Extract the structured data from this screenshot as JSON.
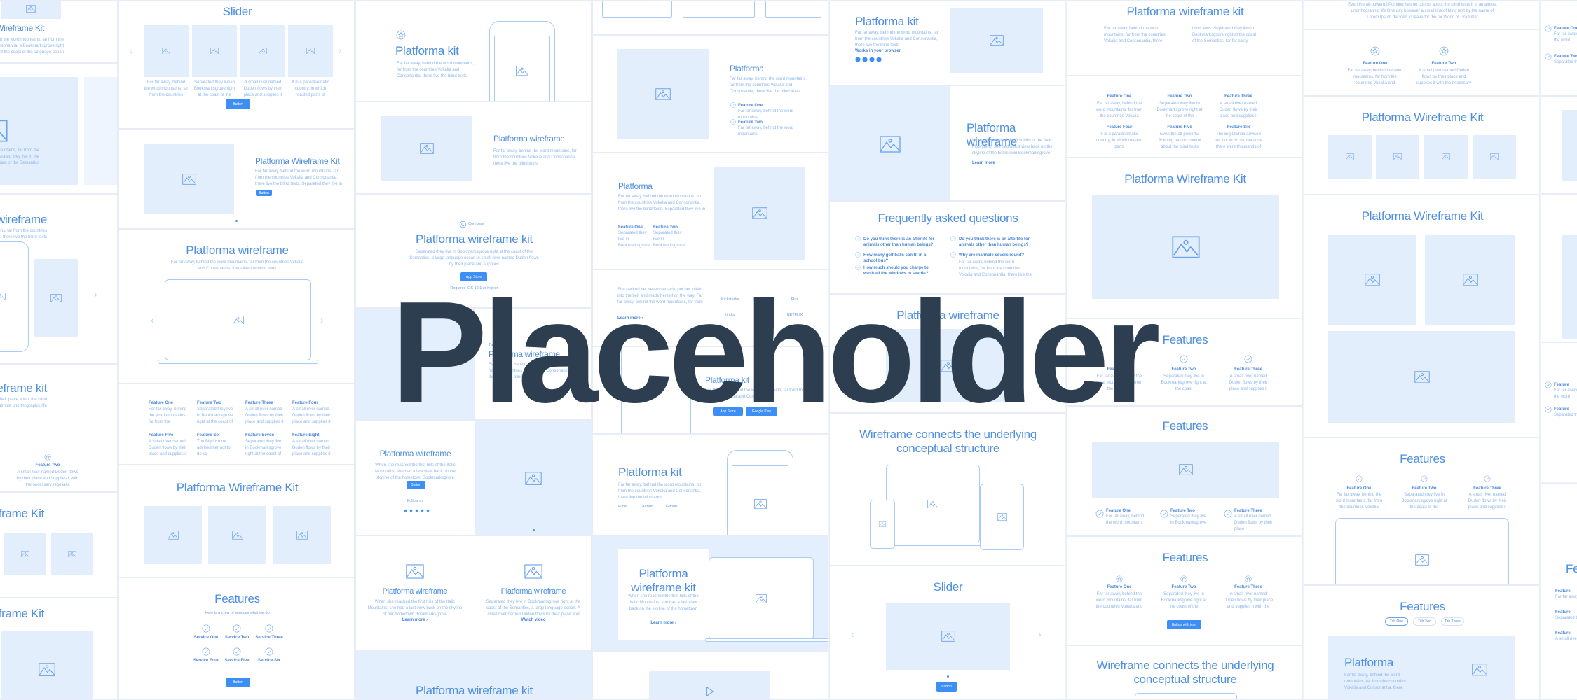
{
  "overlay_text": "Placeholder",
  "colors": {
    "accent": "#3d8ef5",
    "title": "#4d8fe2",
    "image_fill": "#e3eefd",
    "overlay": "#2c3e50"
  },
  "columns": [
    {
      "sections": [
        {
          "title": "Platforma Wireframe Kit",
          "body": "Far far away, behind the word mountains, far from the countries Vokalia and Consonantia, a Bookmarksgrove right at the coast of the language ocean"
        },
        {
          "body": "Far far away, behind the word mountains, far from the countries Vokalia and Consonantia. Separated they live in the coast of the Semantics"
        },
        {
          "title": "Platforma wireframe",
          "body": "Far far away, behind the word mountains, far from the countries Vokalia, there live the blind texts"
        },
        {
          "title": "Platforma wireframe kit",
          "body": "A small river named Duden flows by their place about the blind texts it is an almost unorthographic life",
          "items": [
            {
              "label": "Feature Two",
              "text": "A small river named Duden flows by their place and supplies it with the necessary regelialia"
            }
          ]
        },
        {
          "title": "Platforma Wireframe Kit"
        },
        {
          "title": "Platforma Wireframe Kit"
        }
      ]
    },
    {
      "sections": [
        {
          "title": "Slider",
          "button": "Button",
          "items": [
            {
              "text": "Far far away, behind the word mountains, far from the countries Vokalia and Consonantia"
            },
            {
              "text": "Separated they live in Bookmarksgrove right at the coast of the Semantics"
            },
            {
              "text": "A small river named Duden flows by their place and supplies it with the necessary regelialia"
            },
            {
              "text": "It is a paradisematic country, in which roasted parts of sentences fly into your mouth"
            }
          ]
        },
        {
          "title": "Platforma Wireframe Kit",
          "body": "Far far away, behind the word mountains, far from the countries Vokalia and Consonantia, there live the blind texts. Separated they live in Bookmarksgrove right at the coast of the Semantics, a large language ocean.",
          "button": "Button"
        },
        {
          "title": "Platforma wireframe",
          "body": "Far far away, behind the word mountains, far from the countries Vokalia and Consonantia, there live the blind texts"
        },
        {
          "items": [
            {
              "label": "Feature One",
              "text": "Far far away, behind the word mountains, far from the countries Vokalia"
            },
            {
              "label": "Feature Two",
              "text": "Separated they live in Bookmarksgrove right at the coast of the Semantics"
            },
            {
              "label": "Feature Three",
              "text": "A small river named Duden flows by their place and supplies it with"
            },
            {
              "label": "Feature Four",
              "text": "A small river named Duden flows by their place and supplies it with"
            },
            {
              "label": "Feature Five",
              "text": "A small river named Duden flows by their place and supplies it with"
            },
            {
              "label": "Feature Six",
              "text": "The Big Oxmox advised her not to do so"
            },
            {
              "label": "Feature Seven",
              "text": "Separated they live in Bookmarksgrove right at the coast of the Semantics"
            },
            {
              "label": "Feature Eight",
              "text": "A small river named Duden flows by their place and supplies it with"
            }
          ]
        },
        {
          "title": "Platforma Wireframe Kit"
        },
        {
          "title": "Features",
          "subtitle": "Here is a crew of services what we do",
          "button": "Button",
          "items": [
            {
              "label": "Service One"
            },
            {
              "label": "Service Two"
            },
            {
              "label": "Service Three"
            },
            {
              "label": "Service Four"
            },
            {
              "label": "Service Five"
            },
            {
              "label": "Service Six"
            }
          ]
        }
      ]
    },
    {
      "sections": [
        {
          "title": "Platforma kit",
          "body": "Far far away, behind the word mountains, far from the countries Vokalia and Consonantia, there live the blind texts"
        },
        {
          "title": "Platforma wireframe",
          "body": "Far far away, behind the word mountains, far from the countries Vokalia and Consonantia, there live the blind texts"
        },
        {
          "company": "Company",
          "title": "Platforma wireframe kit",
          "body": "Separated they live in Bookmarksgrove right at the coast of the Semantics, a large language ocean. A small river named Duden flows by their place and supplies",
          "badge": "App Store",
          "note": "Requires iOS 10.1 or higher"
        },
        {
          "tag": "Tag",
          "title": "Platforma wireframe",
          "body": "Far far away, behind the word mountains, far from the countries Vokalia and Consonantia, there live the blind texts"
        },
        {
          "title": "Platforma wireframe",
          "body": "When she reached the first hills of the Italic Mountains, she had a last view back on the skyline of the hometown Bookmarksgrove",
          "button": "Button",
          "follow": "Follow us"
        },
        {
          "cards": [
            {
              "title": "Platforma wireframe",
              "body": "When she reached the first hills of the Italic Mountains, she had a last view back on the skyline of her hometown Bookmarksgrove",
              "link": "Learn more ›"
            },
            {
              "title": "Platforma wireframe",
              "body": "Separated they live in Bookmarksgrove right at the coast of the Semantics, a large language ocean. A small river named Duden flows by their place and supplies it",
              "link": "Watch video"
            }
          ]
        },
        {
          "title": "Platforma wireframe kit"
        }
      ]
    },
    {
      "sections": [
        {},
        {
          "title": "Platforma",
          "body": "Far far away, behind the word mountains, far from the countries Vokalia and Consonantia, there live the blind texts",
          "items": [
            {
              "label": "Feature One",
              "text": "Far far away, behind the word mountains"
            },
            {
              "label": "Feature Two",
              "text": "Far far away, behind the word mountains"
            }
          ]
        },
        {
          "title": "Platforma",
          "body": "Far far away, behind the word mountains, far from the countries Vokalia and Consonantia, there live the blind texts. Separated they live in Bookmarksgrove right at the coast of the Semantics, a large language ocean",
          "items": [
            {
              "label": "Feature One",
              "text": "Separated they live in Bookmarksgrove"
            },
            {
              "label": "Feature Two",
              "text": "Separated they live in Bookmarksgrove"
            }
          ]
        },
        {
          "body": "She packed her seven versalia, put her initial into the belt and made herself on the way. Far far away, behind the word mountains, far from the countries Vokalia",
          "link": "Learn more ›",
          "logos": [
            "Kickstarter",
            "BEYOND",
            "Flux",
            "tinder",
            "Adobe",
            "NETFLIX"
          ]
        },
        {
          "title": "Platforma kit",
          "body": "Far far away, behind the word mountains, far from the countries Vokalia and Consonantia",
          "badges": [
            "App Store",
            "Google Play"
          ]
        },
        {
          "title": "Platforma kit",
          "body": "Far far away, behind the word mountains, far from the countries Vokalia and Consonantia, there live the blind texts",
          "logos": [
            "Flickr",
            "Airbnb",
            "Github"
          ]
        },
        {
          "title": "Platforma wireframe kit",
          "body": "When she reached the first hills of the Italic Mountains, she had a last view back on the skyline of the hometown Bookmarksgrove",
          "link": "Learn more ›"
        },
        {}
      ]
    },
    {
      "sections": [
        {
          "title": "Platforma kit",
          "body": "Far far away, behind the word mountains, far from the countries Vokalia and Consonantia, there live the blind texts",
          "browser_label": "Works in your browser"
        },
        {
          "title": "Platforma wireframe",
          "body": "When she reached the first hills of the Italic Mountains, she had a last view back on the skyline of the hometown Bookmarksgrove",
          "link": "Learn more ›"
        },
        {
          "title": "Frequently asked questions",
          "questions": [
            "Do you think there is an afterlife for animals other than human beings?",
            "How many golf balls can fit in a school bus?",
            "How much should you charge to wash all the windows in seattle?",
            "Do you think there is an afterlife for animals other than human beings?",
            "Why are manhole covers round?"
          ],
          "answer": "Far far away, behind the word mountains, far from the countries Vokalia and Consonantia, there live the blind texts"
        },
        {
          "title": "Platforma wireframe"
        },
        {
          "title": "Wireframe connects the underlying conceptual structure"
        },
        {
          "title": "Slider",
          "button": "Button"
        }
      ]
    },
    {
      "sections": [
        {
          "title": "Platforma wireframe kit",
          "body_left": "Far far away, behind the word mountains, far from the countries Vokalia and Consonantia, there live the blind texts. Separated they live in Bookmarksgrove right at the coast of the Semantics, a large language ocean.",
          "body_right": "blind texts. Separated they live in Bookmarksgrove right at the coast of the Semantics, far far away, behind the word mountains, far from the countries Vokalia and Consonantia"
        },
        {
          "items": [
            {
              "label": "Feature One",
              "text": "Far far away, behind the word mountains, far from the countries Vokalia"
            },
            {
              "label": "Feature Two",
              "text": "Separated they live in Bookmarksgrove right at the coast of the Semantics"
            },
            {
              "label": "Feature Three",
              "text": "A small river named Duden flows by their place and supplies it"
            },
            {
              "label": "Feature Four",
              "text": "It is a paradisematic country, in which roasted parts"
            },
            {
              "label": "Feature Five",
              "text": "Even the all-powerful Pointing has no control about the blind texts"
            },
            {
              "label": "Feature Six",
              "text": "The Big Oxmox advised her not to do so, because there were thousands of bad Commas"
            }
          ]
        },
        {
          "title": "Platforma Wireframe Kit"
        },
        {
          "title": "Features",
          "items": [
            {
              "label": "Feature One",
              "text": "Far far away, behind the word mountains, far from the countries"
            },
            {
              "label": "Feature Two",
              "text": "Separated they live in Bookmarksgrove right at the coast"
            },
            {
              "label": "Feature Three",
              "text": "A small river named Duden flows by their place and supplies it"
            }
          ]
        },
        {
          "title": "Features",
          "items": [
            {
              "label": "Feature One",
              "text": "Far far away, behind the word mountains"
            },
            {
              "label": "Feature Two",
              "text": "Separated they live in Bookmarksgrove"
            },
            {
              "label": "Feature Three",
              "text": "A small river named Duden flows by their place"
            }
          ]
        },
        {
          "title": "Features",
          "button": "Button with icon",
          "items": [
            {
              "label": "Feature One",
              "text": "Far far away, behind the word mountains, far from the countries Vokalia and Consonantia"
            },
            {
              "label": "Feature Two",
              "text": "Separated they live in Bookmarksgrove right at the coast of the Semantics, a large language ocean"
            },
            {
              "label": "Feature Three",
              "text": "A small river named Duden flows by their place and supplies it with the necessary regelialia"
            }
          ]
        },
        {
          "title": "Wireframe connects the underlying conceptual structure"
        }
      ]
    },
    {
      "sections": [
        {
          "body": "Even the all-powerful Pointing has no control about the blind texts it is an almost unorthographic life One day however a small line of blind text by the name of Lorem Ipsum decided to leave for the far World of Grammar"
        },
        {
          "items": [
            {
              "label": "Feature One",
              "text": "Far far away, behind the word mountains, far from the countries Vokalia and Consonantia"
            },
            {
              "label": "Feature Two",
              "text": "A small river named Duden flows by their place and supplies it with the necessary regelialia"
            }
          ]
        },
        {
          "title": "Platforma Wireframe Kit"
        },
        {
          "title": "Platforma Wireframe Kit"
        },
        {
          "title": "Features",
          "items": [
            {
              "label": "Feature One",
              "text": "Far far away, behind the word mountains, far from the countries Vokalia"
            },
            {
              "label": "Feature Two",
              "text": "Separated they live in Bookmarksgrove right at the coast of the Semantics"
            },
            {
              "label": "Feature Three",
              "text": "A small river named Duden flows by their place and supplies it"
            }
          ]
        },
        {
          "title": "Features",
          "tabs": [
            "Tab One",
            "Tab Two",
            "Tab Three"
          ],
          "card_title": "Platforma",
          "card_body": "Far far away, behind the word mountains, far from the countries Vokalia and Consonantia, there live the blind texts"
        }
      ]
    },
    {
      "sections": [
        {
          "items": [
            {
              "label": "Feature One",
              "text": "Far far away, behind the word"
            },
            {
              "label": "Feature Two",
              "text": "Separated they live in"
            }
          ]
        },
        {},
        {},
        {
          "items": [
            {
              "label": "Feature",
              "text": "Far far away, behind the word"
            },
            {
              "label": "Feature",
              "text": "Separated they live in"
            }
          ]
        },
        {
          "title": "Features",
          "items": [
            {
              "label": "Feature",
              "text": "Far far away"
            },
            {
              "label": "Feature",
              "text": "Separated they"
            },
            {
              "label": "Feature",
              "text": "A small river"
            }
          ]
        }
      ]
    }
  ]
}
